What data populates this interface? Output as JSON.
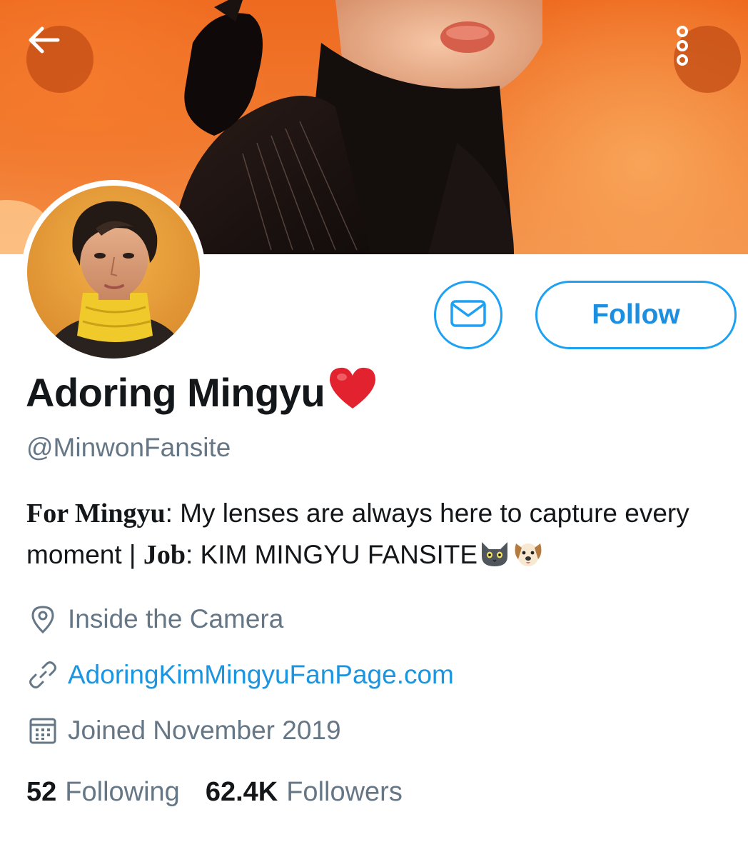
{
  "profile": {
    "display_name": "Adoring Mingyu",
    "handle": "@MinwonFansite",
    "bio": {
      "part1_bold": "For Mingyu",
      "part1_rest": ": My lenses are always here to capture every moment  |",
      "part2_bold": "Job",
      "part2_rest": ": KIM MINGYU FANSITE"
    },
    "location": "Inside the Camera",
    "website": "AdoringKimMingyuFanPage.com",
    "joined": "Joined November 2019",
    "following_count": "52",
    "following_label": "Following",
    "followers_count": "62.4K",
    "followers_label": "Followers"
  },
  "actions": {
    "follow_label": "Follow"
  },
  "icons": {
    "back": "arrow-left-icon",
    "more": "more-vertical-icon",
    "message": "envelope-icon",
    "location": "location-pin-icon",
    "link": "link-icon",
    "calendar": "calendar-icon",
    "name_emoji": "red-heart",
    "bio_emojis": [
      "cat-face",
      "dog-face"
    ]
  },
  "colors": {
    "accent": "#1da1f2",
    "banner": "#ee6a1f",
    "secondary_text": "#657786"
  }
}
